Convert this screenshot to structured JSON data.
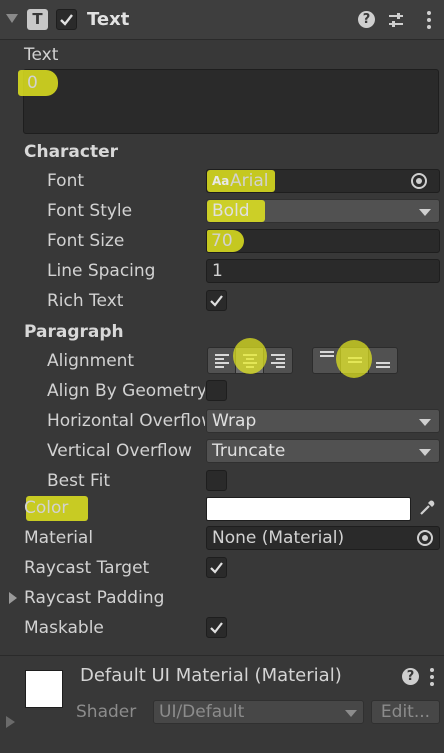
{
  "header": {
    "title": "Text"
  },
  "text_field": {
    "label": "Text",
    "value": "0"
  },
  "character": {
    "section": "Character",
    "font_label": "Font",
    "font_value": "Arial",
    "font_icon_text": "Aa",
    "font_style_label": "Font Style",
    "font_style_value": "Bold",
    "font_size_label": "Font Size",
    "font_size_value": "70",
    "line_spacing_label": "Line Spacing",
    "line_spacing_value": "1",
    "rich_text_label": "Rich Text",
    "rich_text_checked": true
  },
  "paragraph": {
    "section": "Paragraph",
    "alignment_label": "Alignment",
    "horizontal_alignment": "center",
    "vertical_alignment": "middle",
    "align_by_geometry_label": "Align By Geometry",
    "align_by_geometry_checked": false,
    "horizontal_overflow_label": "Horizontal Overflow",
    "horizontal_overflow_value": "Wrap",
    "vertical_overflow_label": "Vertical Overflow",
    "vertical_overflow_value": "Truncate",
    "best_fit_label": "Best Fit",
    "best_fit_checked": false
  },
  "color": {
    "label": "Color",
    "value": "#FFFFFF"
  },
  "material": {
    "label": "Material",
    "value": "None (Material)"
  },
  "raycast_target": {
    "label": "Raycast Target",
    "checked": true
  },
  "raycast_padding": {
    "label": "Raycast Padding"
  },
  "maskable": {
    "label": "Maskable",
    "checked": true
  },
  "material_preview": {
    "title": "Default UI Material (Material)",
    "shader_label": "Shader",
    "shader_value": "UI/Default",
    "edit_label": "Edit..."
  },
  "colors": {
    "highlight": "#E8EC1E",
    "panel": "#383838",
    "field": "#2A2A2A"
  }
}
